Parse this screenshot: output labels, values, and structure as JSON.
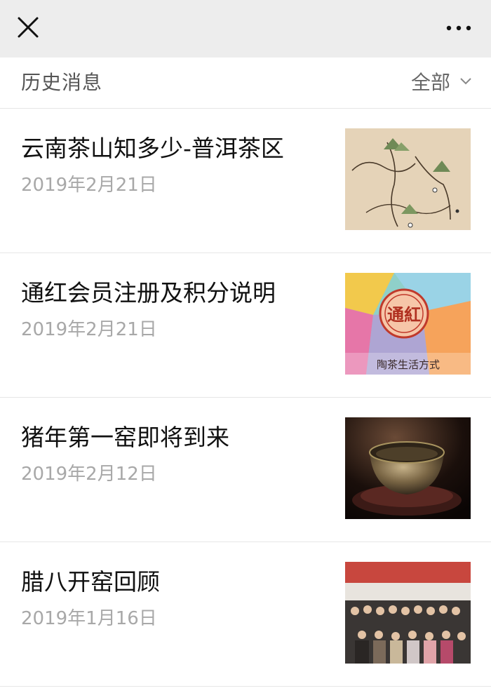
{
  "header": {
    "close_icon": "close-icon",
    "more_icon": "more-horizontal-icon"
  },
  "section": {
    "title": "历史消息",
    "filter_label": "全部"
  },
  "articles": [
    {
      "title": "云南茶山知多少-普洱茶区",
      "date": "2019年2月21日",
      "thumbnail": "tea-map-illustration"
    },
    {
      "title": "通红会员注册及积分说明",
      "date": "2019年2月21日",
      "thumbnail": "colorful-seal-logo",
      "thumbnail_text": "陶茶生活方式"
    },
    {
      "title": "猪年第一窑即将到来",
      "date": "2019年2月12日",
      "thumbnail": "ceramic-tea-cup-photo"
    },
    {
      "title": "腊八开窑回顾",
      "date": "2019年1月16日",
      "thumbnail": "group-photo"
    }
  ]
}
